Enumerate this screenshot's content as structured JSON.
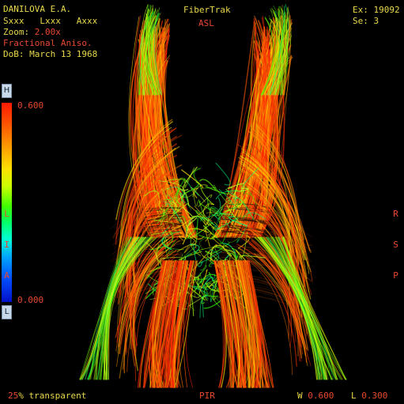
{
  "patient": {
    "name": "DANILOVA E.A.",
    "position": "Sxxx   Lxxx   Axxx",
    "zoom_label": "Zoom: ",
    "zoom_value": "2.00x",
    "map_type": "Fractional Aniso.",
    "dob": "DoB: March 13 1968"
  },
  "header": {
    "app_name": "FiberTrak",
    "orientation": "ASL"
  },
  "exam": {
    "exam_number": "Ex: 19092",
    "series": "Se: 3"
  },
  "colorbar": {
    "high_button": "H",
    "low_button": "L",
    "max_value": "0.600",
    "min_value": "0.000",
    "left_labels": [
      "L",
      "I",
      "A"
    ],
    "right_labels": [
      "R",
      "S",
      "P"
    ]
  },
  "footer": {
    "transparency_value": "25",
    "transparency_label": "% transparent",
    "bottom_orientation": "PIR",
    "window_label": "W ",
    "window_value": "0.600",
    "level_label": "L ",
    "level_value": "0.300"
  },
  "colors": {
    "overlay_yellow": "#e8d84a",
    "overlay_red": "#e84830",
    "background": "#000000",
    "fa_high": "#ff1a00",
    "fa_mid": "#40ff00",
    "fa_low": "#0010c8"
  }
}
